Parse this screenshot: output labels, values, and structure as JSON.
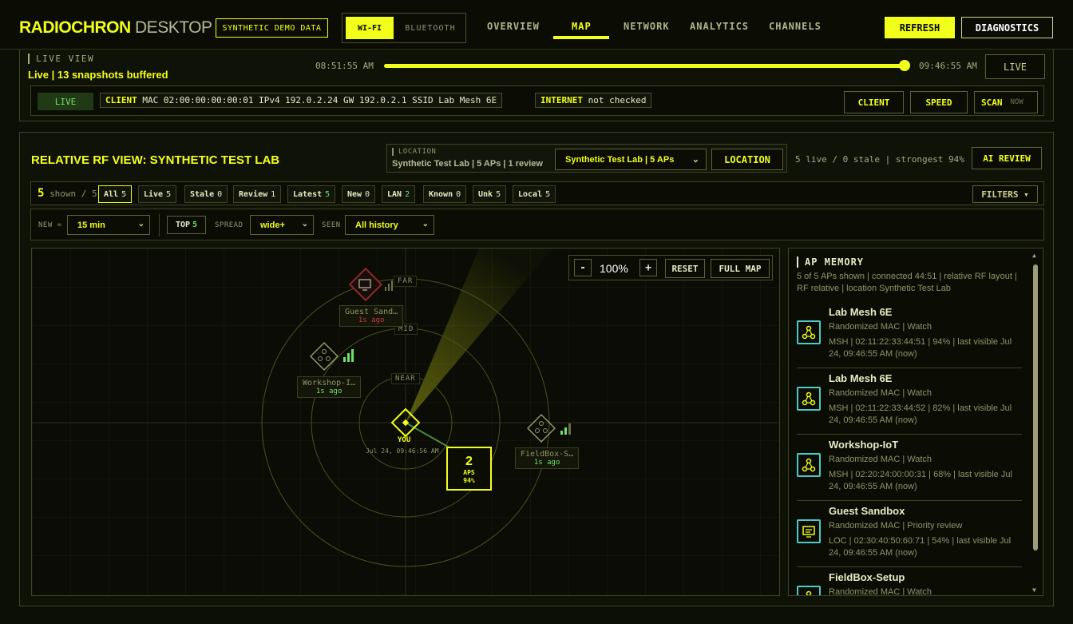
{
  "app": {
    "brand_main": "RADIOCHRON",
    "brand_sub": "DESKTOP",
    "demo_label": "SYNTHETIC DEMO DATA",
    "radios": [
      "WI-FI",
      "BLUETOOTH"
    ],
    "nav": [
      "OVERVIEW",
      "MAP",
      "NETWORK",
      "ANALYTICS",
      "CHANNELS"
    ],
    "active_nav": "MAP",
    "refresh": "REFRESH",
    "diagnostics": "DIAGNOSTICS"
  },
  "live_view": {
    "title": "LIVE VIEW",
    "status": "Live | 13 snapshots buffered",
    "time_start": "08:51:55 AM",
    "time_end": "09:46:55 AM",
    "slider_position": 1.0,
    "live_button": "LIVE",
    "live_badge": "LIVE",
    "client_label": "CLIENT",
    "client_info": "MAC 02:00:00:00:00:01 IPv4 192.0.2.24 GW 192.0.2.1 SSID Lab Mesh 6E",
    "internet_label": "INTERNET",
    "internet_status": "not checked",
    "client_btn": "CLIENT",
    "speed_btn": "SPEED",
    "scan_btn": "SCAN",
    "scan_sub": "NOW"
  },
  "rf_view": {
    "title": "RELATIVE RF VIEW: SYNTHETIC TEST LAB",
    "location_label": "LOCATION",
    "location_value": "Synthetic Test Lab | 5 APs | 1 review",
    "location_select": "Synthetic Test Lab | 5 APs",
    "location_btn": "LOCATION",
    "summary": "5 live / 0 stale | strongest 94%",
    "ai_review": "AI REVIEW"
  },
  "filters": {
    "shown_count": "5",
    "shown_text": "shown / 5",
    "chips": [
      {
        "label": "All",
        "count": "5"
      },
      {
        "label": "Live",
        "count": "5"
      },
      {
        "label": "Stale",
        "count": "0"
      },
      {
        "label": "Review",
        "count": "1"
      },
      {
        "label": "Latest",
        "count": "5"
      },
      {
        "label": "New",
        "count": "0"
      },
      {
        "label": "LAN",
        "count": "2"
      },
      {
        "label": "Known",
        "count": "0"
      },
      {
        "label": "Unk",
        "count": "5"
      },
      {
        "label": "Local",
        "count": "5"
      }
    ],
    "filters_btn": "FILTERS ▾"
  },
  "options": {
    "new_label": "NEW =",
    "new_value": "15 min",
    "top_label": "TOP",
    "top_value": "5",
    "spread_label": "SPREAD",
    "spread_value": "wide+",
    "seen_label": "SEEN",
    "seen_value": "All history"
  },
  "map": {
    "zoom": "100%",
    "zoom_minus": "-",
    "zoom_plus": "+",
    "reset": "RESET",
    "full_map": "FULL MAP",
    "rings": [
      "FAR",
      "MID",
      "NEAR"
    ],
    "you_label": "YOU",
    "you_time": "Jul 24, 09:46:56 AM",
    "cluster_count": "2",
    "cluster_text": "APS",
    "cluster_strength": "94%",
    "aps": [
      {
        "name": "Guest Sand…",
        "ago": "1s ago",
        "icon": "monitor-icon",
        "flag": "review"
      },
      {
        "name": "Workshop-I…",
        "ago": "1s ago",
        "icon": "mesh-icon",
        "flag": "live"
      },
      {
        "name": "FieldBox-S…",
        "ago": "1s ago",
        "icon": "mesh-icon",
        "flag": "live"
      }
    ],
    "colors": {
      "accent": "#f2ff1a",
      "live": "#6fe06a",
      "review": "#c93a3a"
    }
  },
  "memory": {
    "title": "AP MEMORY",
    "subtitle": "5 of 5 APs shown | connected 44:51 | relative RF layout | RF relative | location Synthetic Test Lab",
    "items": [
      {
        "name": "Lab Mesh 6E",
        "meta": "Randomized MAC | Watch",
        "detail": "MSH | 02:11:22:33:44:51 | 94% | last visible Jul 24, 09:46:55 AM (now)",
        "icon": "mesh-icon"
      },
      {
        "name": "Lab Mesh 6E",
        "meta": "Randomized MAC | Watch",
        "detail": "MSH | 02:11:22:33:44:52 | 82% | last visible Jul 24, 09:46:55 AM (now)",
        "icon": "mesh-icon"
      },
      {
        "name": "Workshop-IoT",
        "meta": "Randomized MAC | Watch",
        "detail": "MSH | 02:20:24:00:00:31 | 68% | last visible Jul 24, 09:46:55 AM (now)",
        "icon": "mesh-icon"
      },
      {
        "name": "Guest Sandbox",
        "meta": "Randomized MAC | Priority review",
        "detail": "LOC | 02:30:40:50:60:71 | 54% | last visible Jul 24, 09:46:55 AM (now)",
        "icon": "monitor-icon"
      },
      {
        "name": "FieldBox-Setup",
        "meta": "Randomized MAC | Watch",
        "detail": "",
        "icon": "mesh-icon"
      }
    ]
  }
}
